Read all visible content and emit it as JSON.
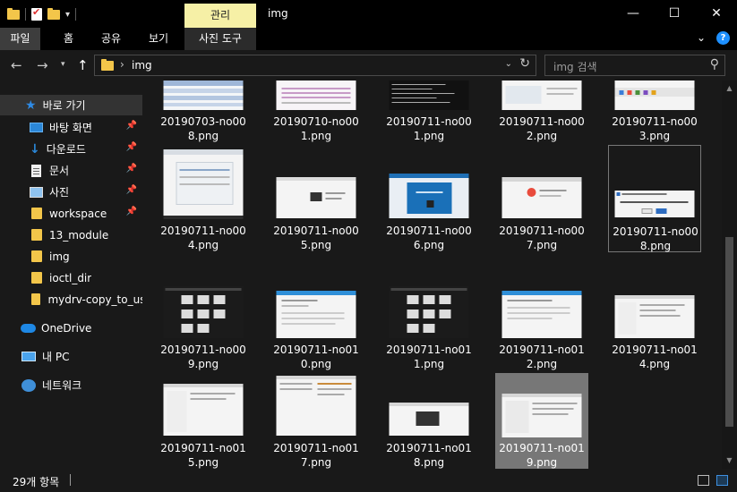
{
  "titlebar": {
    "manage_tab": "관리",
    "title": "img",
    "minimize": "—",
    "maximize": "☐",
    "close": "✕"
  },
  "ribbon": {
    "tabs": [
      "파일",
      "홈",
      "공유",
      "보기"
    ],
    "tools_tab": "사진 도구",
    "expand_icon": "chevron-down-icon",
    "help": "?"
  },
  "address": {
    "path": "img",
    "search_placeholder": "img 검색"
  },
  "nav": {
    "quick_access": "바로 가기",
    "items": [
      {
        "label": "바탕 화면",
        "icon": "desktop-icon",
        "pinned": true
      },
      {
        "label": "다운로드",
        "icon": "download-icon",
        "pinned": true
      },
      {
        "label": "문서",
        "icon": "document-icon",
        "pinned": true
      },
      {
        "label": "사진",
        "icon": "pictures-icon",
        "pinned": true
      },
      {
        "label": "workspace",
        "icon": "folder-icon",
        "pinned": true
      },
      {
        "label": "13_module",
        "icon": "folder-icon",
        "pinned": false
      },
      {
        "label": "img",
        "icon": "folder-icon",
        "pinned": false
      },
      {
        "label": "ioctl_dir",
        "icon": "folder-icon",
        "pinned": false
      },
      {
        "label": "mydrv-copy_to_user",
        "icon": "folder-icon",
        "pinned": false
      }
    ],
    "onedrive": "OneDrive",
    "this_pc": "내 PC",
    "network": "네트워크"
  },
  "files": [
    {
      "line1": "20190703-no00",
      "line2": "8.png"
    },
    {
      "line1": "20190710-no00",
      "line2": "1.png"
    },
    {
      "line1": "20190711-no00",
      "line2": "1.png"
    },
    {
      "line1": "20190711-no00",
      "line2": "2.png"
    },
    {
      "line1": "20190711-no00",
      "line2": "3.png"
    },
    {
      "line1": "20190711-no00",
      "line2": "4.png"
    },
    {
      "line1": "20190711-no00",
      "line2": "5.png"
    },
    {
      "line1": "20190711-no00",
      "line2": "6.png"
    },
    {
      "line1": "20190711-no00",
      "line2": "7.png"
    },
    {
      "line1": "20190711-no00",
      "line2": "8.png"
    },
    {
      "line1": "20190711-no00",
      "line2": "9.png"
    },
    {
      "line1": "20190711-no01",
      "line2": "0.png"
    },
    {
      "line1": "20190711-no01",
      "line2": "1.png"
    },
    {
      "line1": "20190711-no01",
      "line2": "2.png"
    },
    {
      "line1": "20190711-no01",
      "line2": "4.png"
    },
    {
      "line1": "20190711-no01",
      "line2": "5.png"
    },
    {
      "line1": "20190711-no01",
      "line2": "7.png"
    },
    {
      "line1": "20190711-no01",
      "line2": "8.png"
    },
    {
      "line1": "20190711-no01",
      "line2": "9.png"
    }
  ],
  "status": {
    "count": "29개 항목"
  },
  "colors": {
    "manage_tab": "#f6f0a6",
    "folder": "#f3c64a",
    "accent": "#2e8be6"
  }
}
